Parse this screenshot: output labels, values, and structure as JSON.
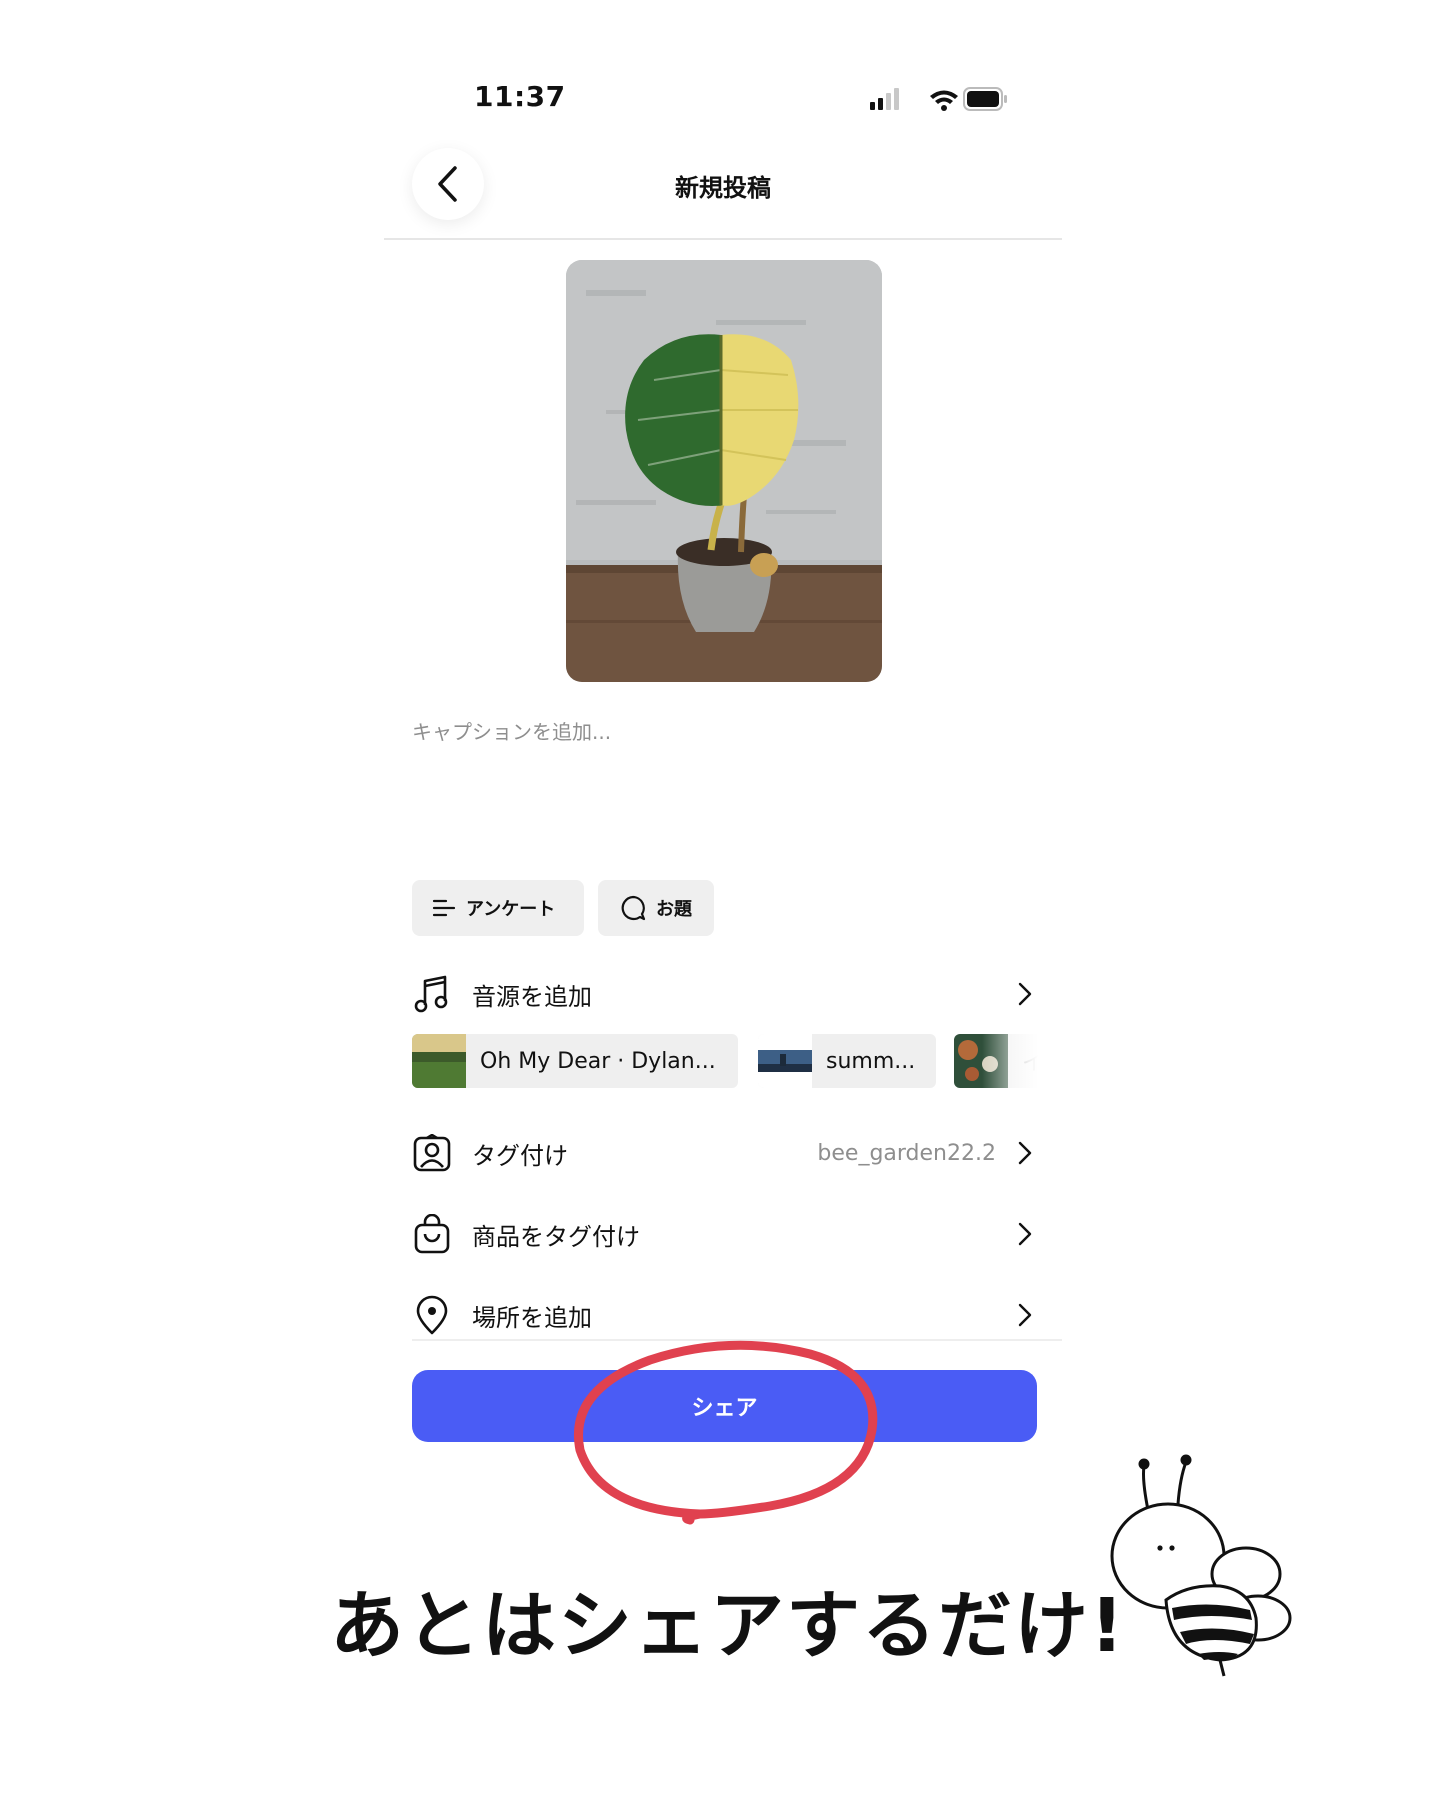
{
  "status_bar": {
    "time": "11:37"
  },
  "nav": {
    "title": "新規投稿"
  },
  "caption": {
    "placeholder": "キャプションを追加..."
  },
  "chips": [
    {
      "label": "アンケート",
      "icon": "list-icon"
    },
    {
      "label": "お題",
      "icon": "speech-bubble-icon"
    }
  ],
  "rows": {
    "music": {
      "label": "音源を追加",
      "icon": "music-note-icon"
    },
    "tag": {
      "label": "タグ付け",
      "value": "bee_garden22.2",
      "icon": "person-tag-icon"
    },
    "product": {
      "label": "商品をタグ付け",
      "icon": "shopping-bag-icon"
    },
    "location": {
      "label": "場所を追加",
      "icon": "location-pin-icon"
    }
  },
  "music_suggestions": [
    {
      "label": "Oh My Dear · Dylan..."
    },
    {
      "label": "summ..."
    },
    {
      "label": "イ"
    }
  ],
  "share": {
    "label": "シェア"
  },
  "overlay": {
    "text": "あとはシェアするだけ!"
  },
  "colors": {
    "accent": "#4a5cf5",
    "annotation": "#e0414f"
  }
}
